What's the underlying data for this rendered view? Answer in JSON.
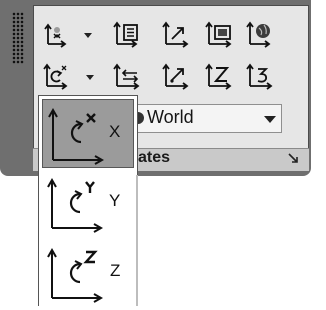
{
  "panel": {
    "title": "ordinates",
    "view_combo": {
      "value": "World"
    }
  },
  "dropdown": {
    "items": [
      {
        "axis": "X",
        "label": "X",
        "selected": true
      },
      {
        "axis": "Y",
        "label": "Y",
        "selected": false
      },
      {
        "axis": "Z",
        "label": "Z",
        "selected": false
      }
    ]
  },
  "icons": {
    "row1": [
      "ucs-origin-icon",
      "ucs-named-icon",
      "ucs-object-icon",
      "ucs-view-icon",
      "ucs-world-icon"
    ],
    "row2": [
      "ucs-rotate-x-icon",
      "ucs-previous-icon",
      "ucs-3point-icon",
      "ucs-z-axis-icon",
      "ucs-3-icon"
    ]
  },
  "colors": {
    "panel_frame": "#6f6f6f",
    "panel_body": "#e6e6e6",
    "selected_item": "#9b9b9b"
  }
}
